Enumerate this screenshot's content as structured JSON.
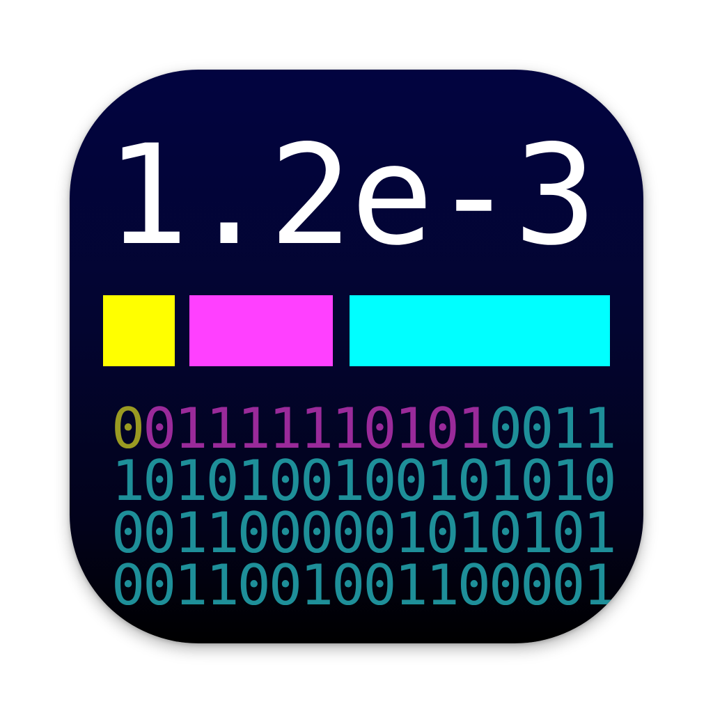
{
  "icon": {
    "value": "1.2e-3",
    "colors": {
      "sign": "#ffff00",
      "exponent": "#ff40ff",
      "mantissa": "#00ffff",
      "sign_bits": "#9a9a22",
      "exponent_bits": "#9a2a9a",
      "mantissa_bits": "#1e8f99",
      "text": "#ffffff"
    },
    "bits": {
      "row1": {
        "sign": "0",
        "exponent": "01111110101",
        "mantissa": "0011"
      },
      "row2": "1010100100101010",
      "row3": "0011000001010101",
      "row4": "0011001001100001"
    }
  }
}
